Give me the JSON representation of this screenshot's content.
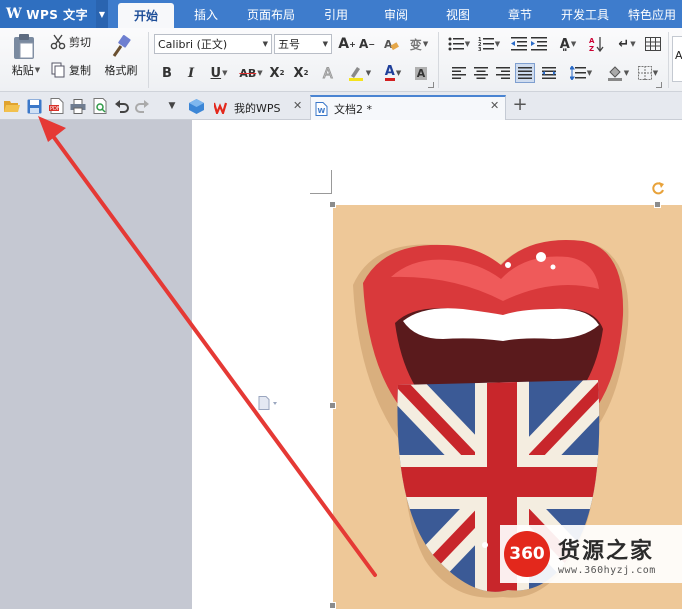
{
  "app": {
    "title": "WPS 文字",
    "logo_glyph": "W"
  },
  "menu_tabs": [
    {
      "label": "开始",
      "active": true
    },
    {
      "label": "插入"
    },
    {
      "label": "页面布局"
    },
    {
      "label": "引用"
    },
    {
      "label": "审阅"
    },
    {
      "label": "视图"
    },
    {
      "label": "章节"
    },
    {
      "label": "开发工具"
    },
    {
      "label": "特色应用"
    }
  ],
  "ribbon": {
    "paste_label": "粘贴",
    "cut_label": "剪切",
    "copy_label": "复制",
    "format_painter_label": "格式刷",
    "font_name": "Calibri (正文)",
    "font_size": "五号",
    "bold": "B",
    "italic": "I",
    "underline": "U",
    "strike": "AB",
    "superscript": "X",
    "subscript": "X",
    "font_color_letter": "A",
    "style_preview": "A"
  },
  "doc_tabs": [
    {
      "label": "我的WPS"
    },
    {
      "label": "文档2 *",
      "active": true
    }
  ],
  "watermark": {
    "badge": "360",
    "name": "货源之家",
    "url": "www.360hyzj.com"
  },
  "colors": {
    "menubar": "#3e7ccc",
    "arrow": "#e53935",
    "picture_bg": "#eec898"
  }
}
